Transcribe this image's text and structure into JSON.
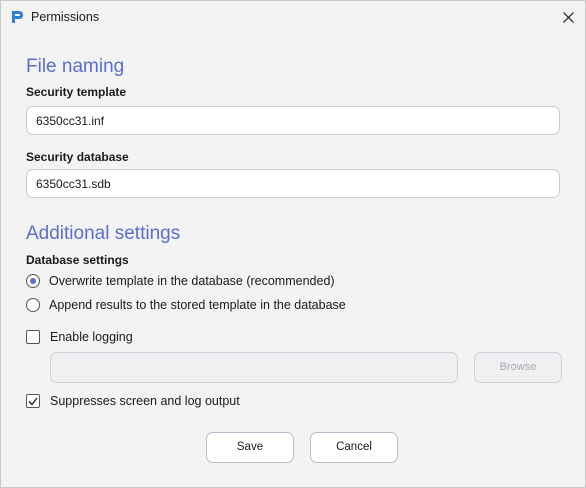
{
  "window": {
    "title": "Permissions"
  },
  "file_naming": {
    "heading": "File naming",
    "security_template_label": "Security template",
    "security_template_value": "6350cc31.inf",
    "security_database_label": "Security database",
    "security_database_value": "6350cc31.sdb"
  },
  "additional": {
    "heading": "Additional settings",
    "database_settings_label": "Database settings",
    "radio_overwrite_label": "Overwrite template in the database (recommended)",
    "radio_append_label": "Append results to the stored template in the database",
    "enable_logging_label": "Enable logging",
    "log_path_value": "",
    "browse_label": "Browse",
    "suppress_label": "Suppresses screen and log output"
  },
  "state": {
    "selected_radio": "overwrite",
    "enable_logging_checked": false,
    "suppress_checked": true
  },
  "footer": {
    "save_label": "Save",
    "cancel_label": "Cancel"
  },
  "colors": {
    "accent": "#5b6ed0",
    "background": "#f3f3f3"
  }
}
